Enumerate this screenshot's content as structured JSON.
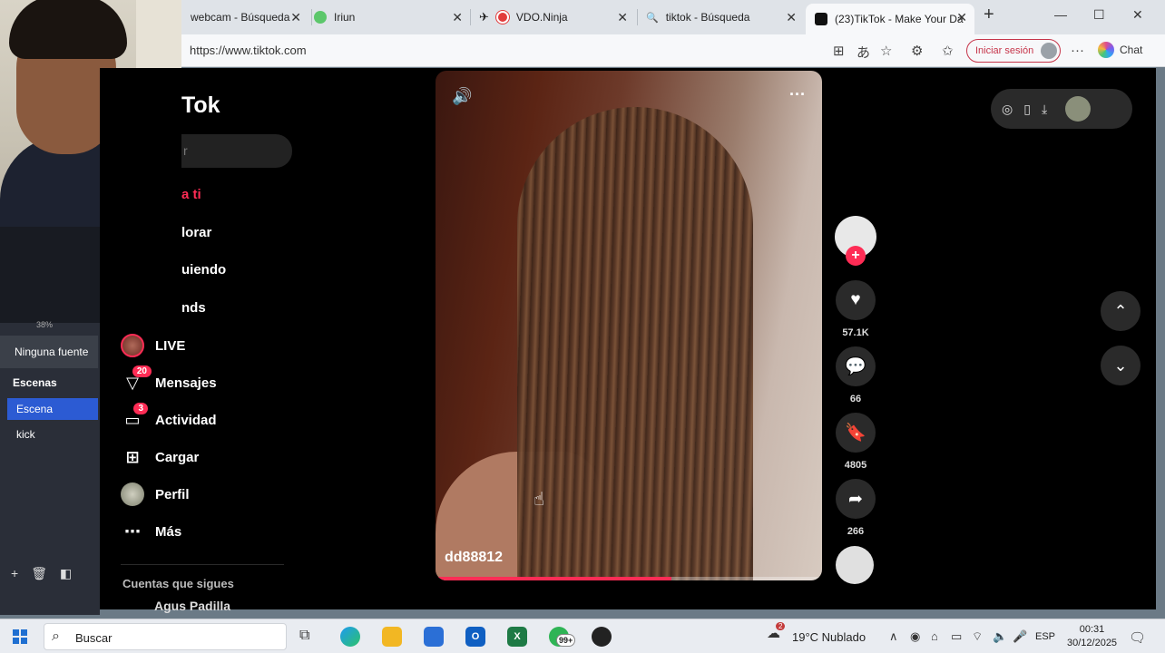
{
  "browser": {
    "tabs": [
      {
        "label": "webcam - Búsqueda",
        "active": false
      },
      {
        "label": "Iriun",
        "active": false
      },
      {
        "label": "VDO.Ninja",
        "active": false
      },
      {
        "label": "tiktok - Búsqueda",
        "active": false
      },
      {
        "label": "(23)TikTok - Make Your Da",
        "active": true
      }
    ],
    "new_tab_glyph": "+",
    "url": "https://www.tiktok.com",
    "signin_label": "Iniciar sesión",
    "chat_label": "Chat"
  },
  "tiktok": {
    "logo_text": "Tok",
    "search_placeholder_fragment": "r",
    "nav_partial": [
      {
        "label": "a ti",
        "color": "#fe2c55"
      },
      {
        "label": "lorar"
      },
      {
        "label": "uiendo"
      },
      {
        "label": "nds"
      }
    ],
    "nav": [
      {
        "label": "LIVE",
        "icon": "live-icon"
      },
      {
        "label": "Mensajes",
        "icon": "messages-icon",
        "badge": "20"
      },
      {
        "label": "Actividad",
        "icon": "activity-icon",
        "badge": "3"
      },
      {
        "label": "Cargar",
        "icon": "upload-icon"
      },
      {
        "label": "Perfil",
        "icon": "profile-icon"
      },
      {
        "label": "Más",
        "icon": "more-icon"
      }
    ],
    "following_title": "Cuentas que sigues",
    "following_user": "Agus Padilla",
    "video": {
      "username": "dd88812",
      "progress": 0.61
    },
    "actions": {
      "likes": "57.1K",
      "comments": "66",
      "saves": "4805",
      "shares": "266"
    }
  },
  "obs": {
    "zoom": "38%",
    "source_text": "Ninguna fuente",
    "scenes_title": "Escenas",
    "scenes": [
      "Escena",
      "kick"
    ]
  },
  "taskbar": {
    "search_label": "Buscar",
    "weather": "19°C  Nublado",
    "weather_badge": "2",
    "whatsapp_badge": "99+",
    "language": "ESP",
    "time": "00:31",
    "date": "30/12/2025"
  },
  "colors": {
    "accent": "#fe2c55",
    "obs_selected": "#2c5bd3"
  }
}
